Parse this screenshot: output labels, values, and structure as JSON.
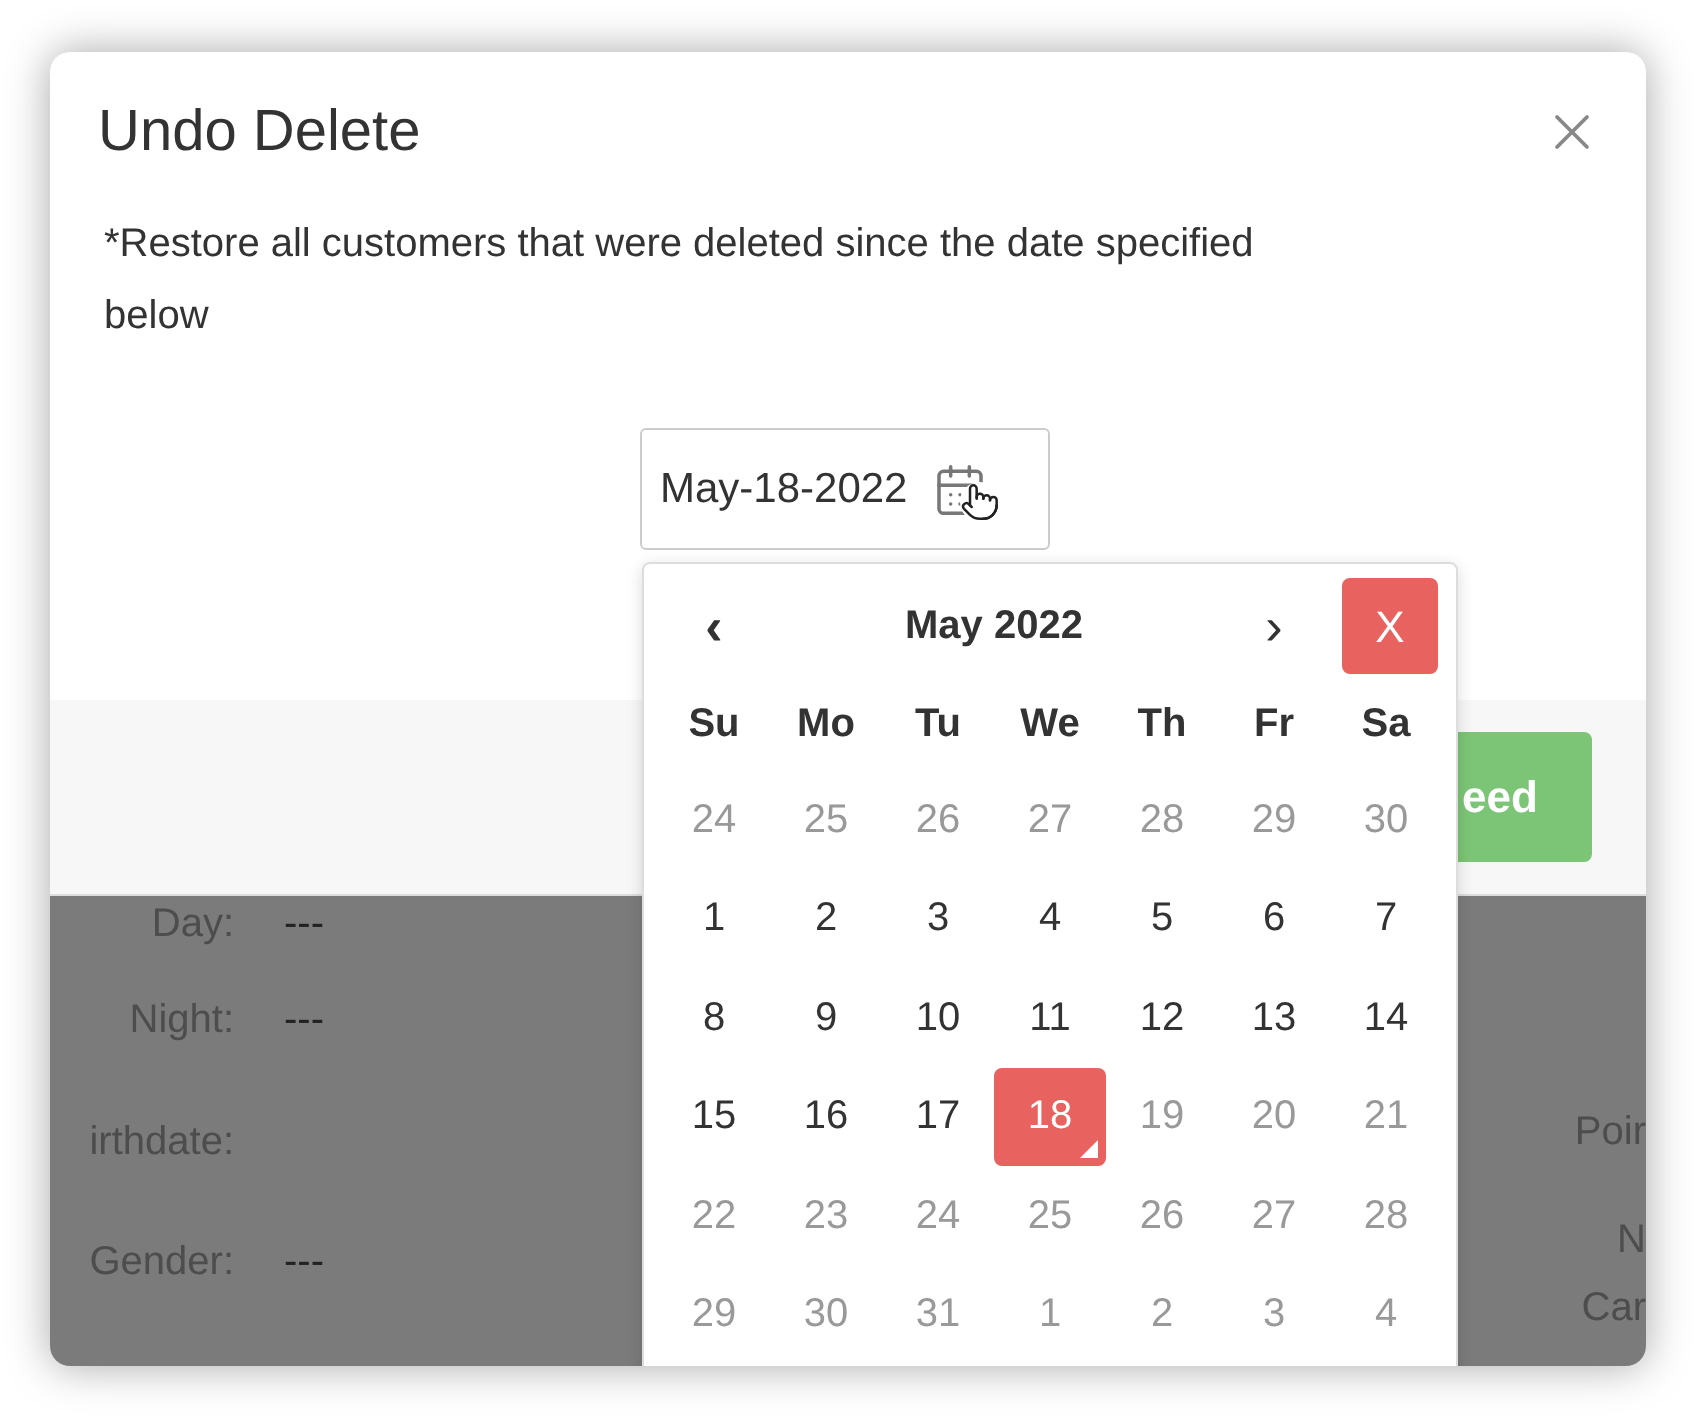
{
  "dialog": {
    "title": "Undo Delete",
    "message": "*Restore all customers that were deleted since the date specified below",
    "date_field": {
      "value": "May-18-2022"
    }
  },
  "footer": {
    "button": "eed"
  },
  "background": {
    "rows": [
      {
        "label": "Day:",
        "value": "---"
      },
      {
        "label": "Night:",
        "value": "---"
      },
      {
        "label": "irthdate:"
      },
      {
        "label": "Gender:",
        "value": "---"
      }
    ],
    "right_labels": [
      "Poir",
      "N",
      "Car"
    ]
  },
  "calendar": {
    "prev": "‹",
    "title": "May 2022",
    "next": "›",
    "close": "X",
    "weekdays": [
      "Su",
      "Mo",
      "Tu",
      "We",
      "Th",
      "Fr",
      "Sa"
    ],
    "weeks": [
      [
        {
          "day": "24",
          "disabled": true,
          "selected": false
        },
        {
          "day": "25",
          "disabled": true,
          "selected": false
        },
        {
          "day": "26",
          "disabled": true,
          "selected": false
        },
        {
          "day": "27",
          "disabled": true,
          "selected": false
        },
        {
          "day": "28",
          "disabled": true,
          "selected": false
        },
        {
          "day": "29",
          "disabled": true,
          "selected": false
        },
        {
          "day": "30",
          "disabled": true,
          "selected": false
        }
      ],
      [
        {
          "day": "1",
          "disabled": false,
          "selected": false
        },
        {
          "day": "2",
          "disabled": false,
          "selected": false
        },
        {
          "day": "3",
          "disabled": false,
          "selected": false
        },
        {
          "day": "4",
          "disabled": false,
          "selected": false
        },
        {
          "day": "5",
          "disabled": false,
          "selected": false
        },
        {
          "day": "6",
          "disabled": false,
          "selected": false
        },
        {
          "day": "7",
          "disabled": false,
          "selected": false
        }
      ],
      [
        {
          "day": "8",
          "disabled": false,
          "selected": false
        },
        {
          "day": "9",
          "disabled": false,
          "selected": false
        },
        {
          "day": "10",
          "disabled": false,
          "selected": false
        },
        {
          "day": "11",
          "disabled": false,
          "selected": false
        },
        {
          "day": "12",
          "disabled": false,
          "selected": false
        },
        {
          "day": "13",
          "disabled": false,
          "selected": false
        },
        {
          "day": "14",
          "disabled": false,
          "selected": false
        }
      ],
      [
        {
          "day": "15",
          "disabled": false,
          "selected": false
        },
        {
          "day": "16",
          "disabled": false,
          "selected": false
        },
        {
          "day": "17",
          "disabled": false,
          "selected": false
        },
        {
          "day": "18",
          "disabled": false,
          "selected": true
        },
        {
          "day": "19",
          "disabled": true,
          "selected": false
        },
        {
          "day": "20",
          "disabled": true,
          "selected": false
        },
        {
          "day": "21",
          "disabled": true,
          "selected": false
        }
      ],
      [
        {
          "day": "22",
          "disabled": true,
          "selected": false
        },
        {
          "day": "23",
          "disabled": true,
          "selected": false
        },
        {
          "day": "24",
          "disabled": true,
          "selected": false
        },
        {
          "day": "25",
          "disabled": true,
          "selected": false
        },
        {
          "day": "26",
          "disabled": true,
          "selected": false
        },
        {
          "day": "27",
          "disabled": true,
          "selected": false
        },
        {
          "day": "28",
          "disabled": true,
          "selected": false
        }
      ],
      [
        {
          "day": "29",
          "disabled": true,
          "selected": false
        },
        {
          "day": "30",
          "disabled": true,
          "selected": false
        },
        {
          "day": "31",
          "disabled": true,
          "selected": false
        },
        {
          "day": "1",
          "disabled": true,
          "selected": false
        },
        {
          "day": "2",
          "disabled": true,
          "selected": false
        },
        {
          "day": "3",
          "disabled": true,
          "selected": false
        },
        {
          "day": "4",
          "disabled": true,
          "selected": false
        }
      ]
    ]
  }
}
